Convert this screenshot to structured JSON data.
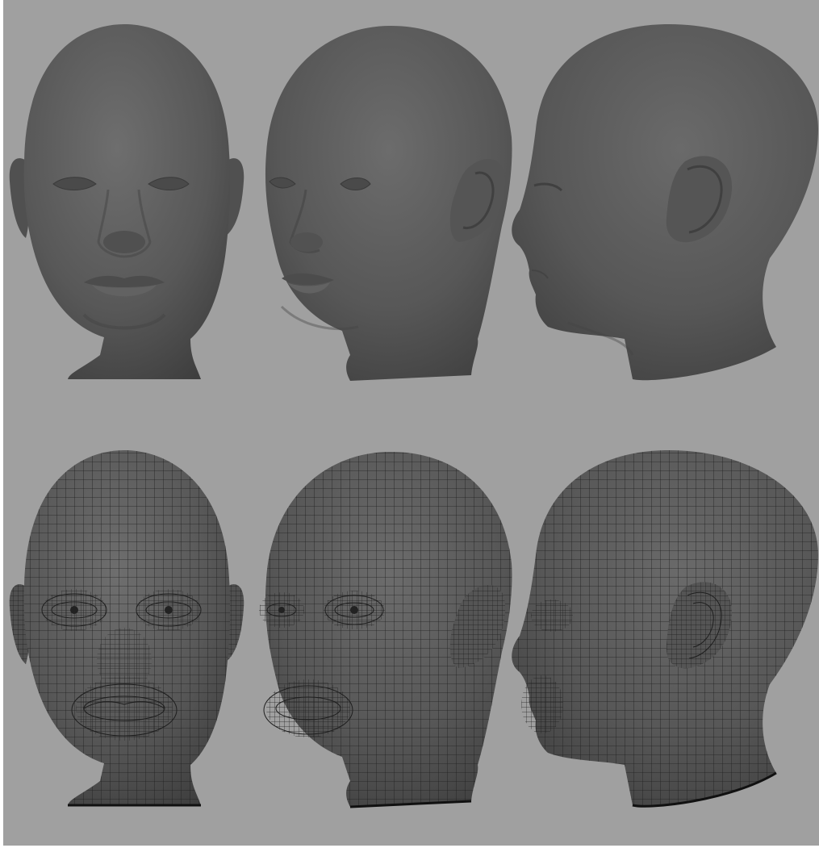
{
  "viewport": {
    "background": "#a0a0a0",
    "border": "#ffffff"
  },
  "material": {
    "base": "#5a5a5a",
    "light": "#707070",
    "dark": "#3a3a3a",
    "wire": "#1a1a1a"
  },
  "views": [
    {
      "row": "smooth",
      "angle": "front"
    },
    {
      "row": "smooth",
      "angle": "three-quarter"
    },
    {
      "row": "smooth",
      "angle": "profile"
    },
    {
      "row": "wireframe",
      "angle": "front"
    },
    {
      "row": "wireframe",
      "angle": "three-quarter"
    },
    {
      "row": "wireframe",
      "angle": "profile"
    }
  ]
}
